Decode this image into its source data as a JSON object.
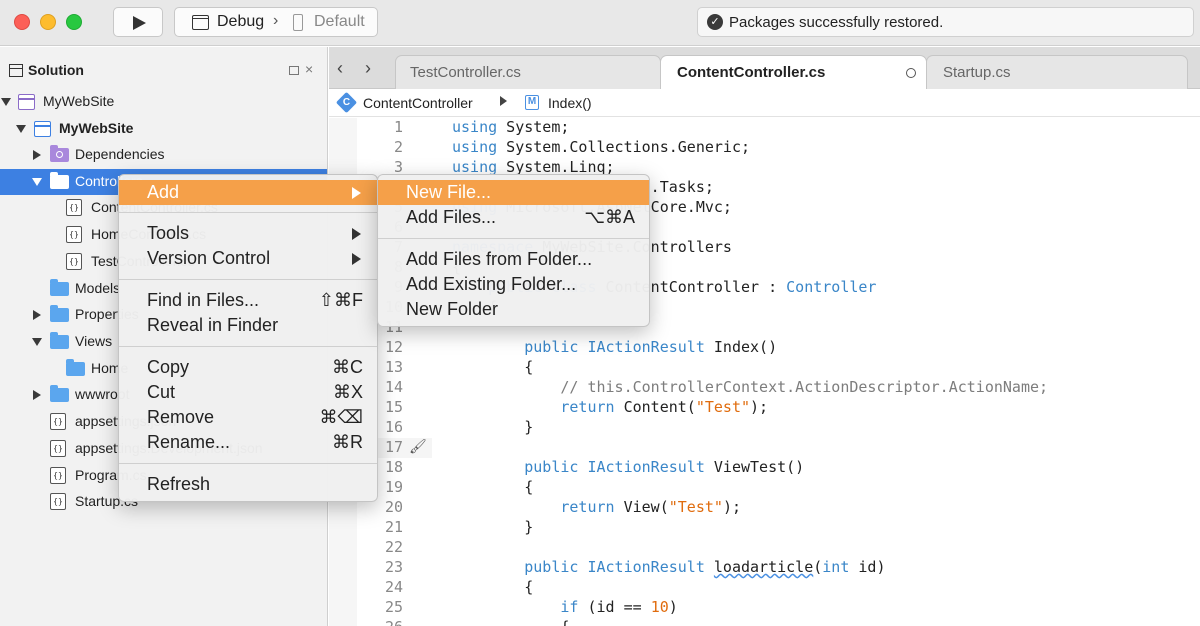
{
  "toolbar": {
    "run_icon": "play-icon",
    "configuration": "Debug",
    "config_separator": "›",
    "device": "Default",
    "status_text": "Packages successfully restored.",
    "status_icon": "check-circle-icon"
  },
  "solution_pane": {
    "title": "Solution",
    "close_glyph": "×",
    "items": [
      {
        "label": "MyWebSite",
        "icon": "solution-icon"
      },
      {
        "label": "MyWebSite",
        "icon": "project-icon"
      },
      {
        "label": "Dependencies",
        "icon": "dependencies-folder-icon"
      },
      {
        "label": "Controllers",
        "icon": "folder-icon"
      },
      {
        "label": "ContentController.cs",
        "icon": "csharp-file-icon"
      },
      {
        "label": "HomeController.cs",
        "icon": "csharp-file-icon"
      },
      {
        "label": "TestController.cs",
        "icon": "csharp-file-icon"
      },
      {
        "label": "Models",
        "icon": "folder-icon"
      },
      {
        "label": "Properties",
        "icon": "folder-icon"
      },
      {
        "label": "Views",
        "icon": "folder-icon"
      },
      {
        "label": "Home",
        "icon": "folder-icon"
      },
      {
        "label": "wwwroot",
        "icon": "folder-icon"
      },
      {
        "label": "appsettings.json",
        "icon": "json-file-icon"
      },
      {
        "label": "appsettings.Development.json",
        "icon": "json-file-icon"
      },
      {
        "label": "Program.cs",
        "icon": "csharp-file-icon"
      },
      {
        "label": "Startup.cs",
        "icon": "csharp-file-icon"
      }
    ],
    "file_icon_glyph": "{}"
  },
  "editor": {
    "back_glyph": "‹",
    "forward_glyph": "›",
    "tabs": [
      {
        "label": "TestController.cs",
        "active": false
      },
      {
        "label": "ContentController.cs",
        "active": true
      },
      {
        "label": "Startup.cs",
        "active": false
      }
    ],
    "breadcrumb": {
      "class_icon_letter": "C",
      "class_name": "ContentController",
      "method_icon_letter": "M",
      "method_name": "Index()"
    },
    "brush_glyph": "🖌"
  },
  "context_menu": {
    "items": [
      {
        "label": "Add",
        "shortcut": "",
        "submenu": true,
        "highlighted": true
      },
      {
        "label": "Tools",
        "shortcut": "",
        "submenu": true
      },
      {
        "label": "Version Control",
        "shortcut": "",
        "submenu": true
      },
      {
        "label": "Find in Files...",
        "shortcut": "⇧⌘F"
      },
      {
        "label": "Reveal in Finder",
        "shortcut": ""
      },
      {
        "label": "Copy",
        "shortcut": "⌘C"
      },
      {
        "label": "Cut",
        "shortcut": "⌘X"
      },
      {
        "label": "Remove",
        "shortcut": "⌘⌫"
      },
      {
        "label": "Rename...",
        "shortcut": "⌘R"
      },
      {
        "label": "Refresh",
        "shortcut": ""
      }
    ]
  },
  "submenu": {
    "items": [
      {
        "label": "New File...",
        "shortcut": "",
        "highlighted": true
      },
      {
        "label": "Add Files...",
        "shortcut": "⌥⌘A"
      },
      {
        "label": "Add Files from Folder...",
        "shortcut": ""
      },
      {
        "label": "Add Existing Folder...",
        "shortcut": ""
      },
      {
        "label": "New Folder",
        "shortcut": ""
      }
    ]
  },
  "colors": {
    "selection": "#3d80e2",
    "menu_highlight": "#f5a049",
    "keyword": "#3a86c8",
    "string": "#e06c0e"
  }
}
